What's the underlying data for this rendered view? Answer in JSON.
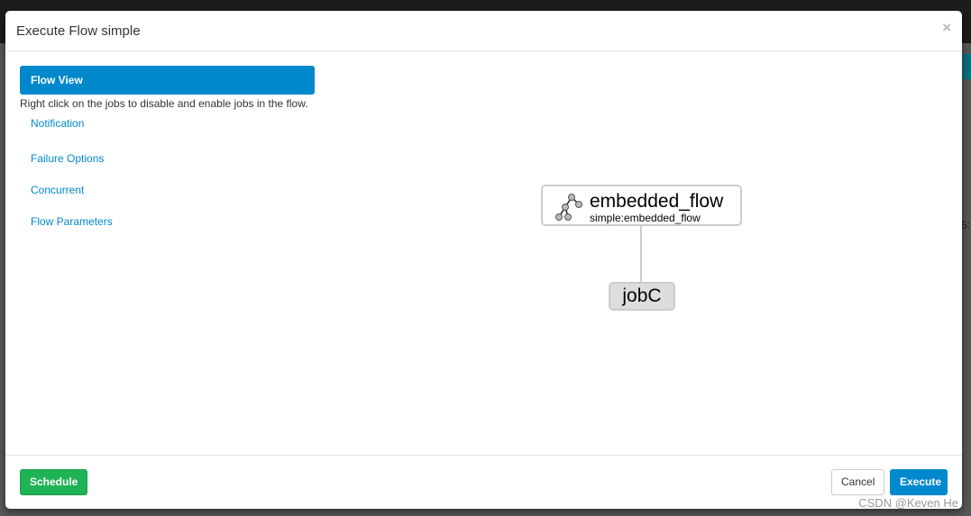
{
  "modal": {
    "title": "Execute Flow simple",
    "close": "×"
  },
  "nav": {
    "active": "Flow View",
    "hint": "Right click on the jobs to disable and enable jobs in the flow.",
    "items": [
      "Notification",
      "Failure Options",
      "Concurrent",
      "Flow Parameters"
    ]
  },
  "graph": {
    "flow_node": {
      "name": "embedded_flow",
      "subtitle": "simple:embedded_flow",
      "icon": "flow-tree-icon"
    },
    "job_node": {
      "name": "jobC"
    }
  },
  "footer": {
    "schedule": "Schedule",
    "cancel": "Cancel",
    "execute": "Execute"
  },
  "background": {
    "partial_text": "5:"
  },
  "watermark": "CSDN @Keven He",
  "colors": {
    "primary": "#0088cc",
    "success": "#1fb355"
  }
}
